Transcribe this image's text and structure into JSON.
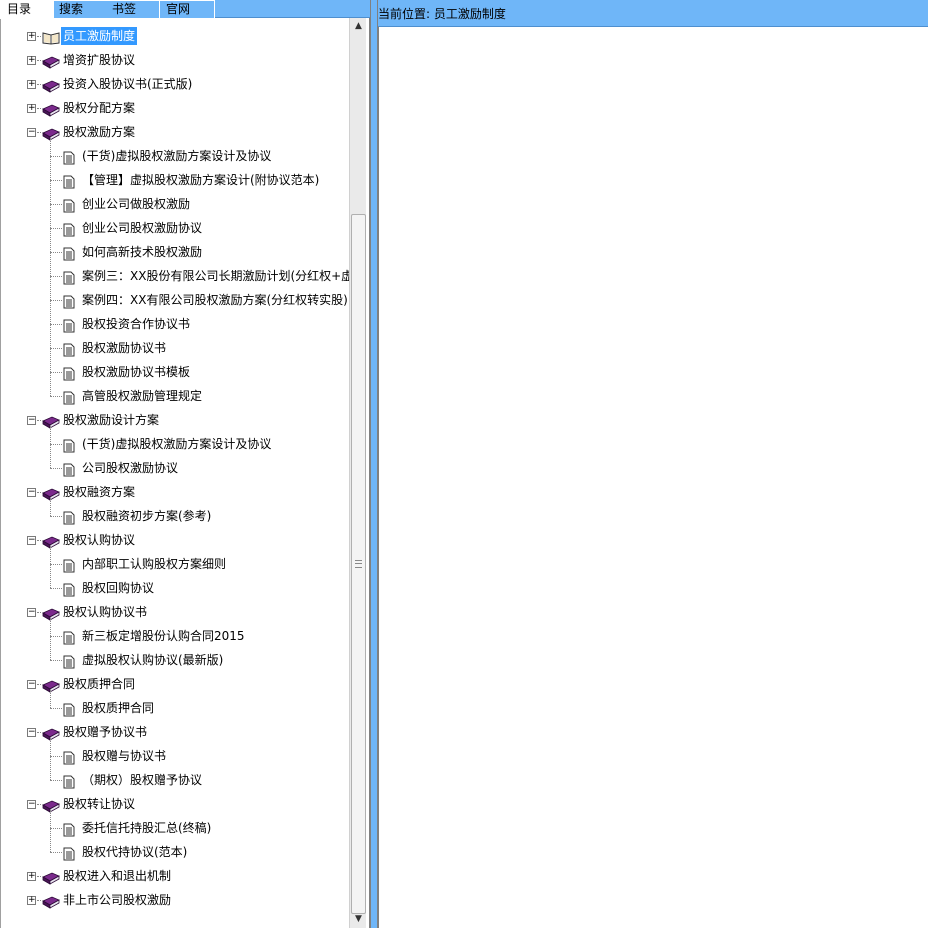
{
  "tabs": [
    {
      "label": "目录",
      "active": true
    },
    {
      "label": "搜索",
      "active": false
    },
    {
      "label": "书签",
      "active": false
    },
    {
      "label": "官网",
      "active": false
    }
  ],
  "location": {
    "text": "当前位置:  员工激励制度"
  },
  "tree": [
    {
      "label": "员工激励制度",
      "type": "book-open",
      "expanded": false,
      "selected": true
    },
    {
      "label": "增资扩股协议",
      "type": "book",
      "expanded": false
    },
    {
      "label": "投资入股协议书(正式版)",
      "type": "book",
      "expanded": false
    },
    {
      "label": "股权分配方案",
      "type": "book",
      "expanded": false
    },
    {
      "label": "股权激励方案",
      "type": "book",
      "expanded": true,
      "children": [
        "(干货)虚拟股权激励方案设计及协议",
        "【管理】虚拟股权激励方案设计(附协议范本)",
        "创业公司做股权激励",
        "创业公司股权激励协议",
        "如何高新技术股权激励",
        "案例三：XX股份有限公司长期激励计划(分红权+虚",
        "案例四：XX有限公司股权激励方案(分红权转实股)",
        "股权投资合作协议书",
        "股权激励协议书",
        "股权激励协议书模板",
        "高管股权激励管理规定"
      ]
    },
    {
      "label": "股权激励设计方案",
      "type": "book",
      "expanded": true,
      "children": [
        "(干货)虚拟股权激励方案设计及协议",
        "公司股权激励协议"
      ]
    },
    {
      "label": "股权融资方案",
      "type": "book",
      "expanded": true,
      "children": [
        "股权融资初步方案(参考)"
      ]
    },
    {
      "label": "股权认购协议",
      "type": "book",
      "expanded": true,
      "children": [
        "内部职工认购股权方案细则",
        "股权回购协议"
      ]
    },
    {
      "label": "股权认购协议书",
      "type": "book",
      "expanded": true,
      "children": [
        "新三板定增股份认购合同2015",
        "虚拟股权认购协议(最新版)"
      ]
    },
    {
      "label": "股权质押合同",
      "type": "book",
      "expanded": true,
      "children": [
        "股权质押合同"
      ]
    },
    {
      "label": "股权赠予协议书",
      "type": "book",
      "expanded": true,
      "children": [
        "股权赠与协议书",
        "（期权）股权赠予协议"
      ]
    },
    {
      "label": "股权转让协议",
      "type": "book",
      "expanded": true,
      "children": [
        "委托信托持股汇总(终稿)",
        "股权代持协议(范本)"
      ]
    },
    {
      "label": "股权进入和退出机制",
      "type": "book",
      "expanded": false
    },
    {
      "label": "非上市公司股权激励",
      "type": "book",
      "expanded": false
    }
  ],
  "icons": {
    "expand": "plus-box-icon",
    "collapse": "minus-box-icon",
    "book": "book-icon",
    "book_open": "open-book-icon",
    "doc": "document-icon"
  },
  "colors": {
    "header_bg": "#6fb6f8",
    "selection": "#3399ff",
    "book": "#7b2a8c"
  }
}
